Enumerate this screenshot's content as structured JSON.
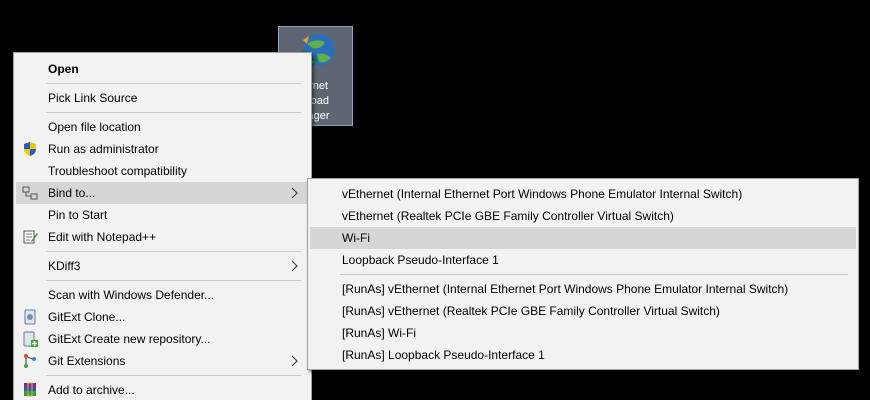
{
  "desktop_icon": {
    "caption_lines": [
      "ernet",
      "nload",
      "nager"
    ]
  },
  "context_menu": {
    "open": "Open",
    "pick_link_source": "Pick Link Source",
    "open_file_location": "Open file location",
    "run_as_administrator": "Run as administrator",
    "troubleshoot_compatibility": "Troubleshoot compatibility",
    "bind_to": "Bind to...",
    "pin_to_start": "Pin to Start",
    "edit_with_notepadpp": "Edit with Notepad++",
    "kdiff3": "KDiff3",
    "scan_with_defender": "Scan with Windows Defender...",
    "gitext_clone": "GitExt Clone...",
    "gitext_create_repo": "GitExt Create new repository...",
    "git_extensions": "Git Extensions",
    "add_to_archive": "Add to archive..."
  },
  "bind_submenu": {
    "items": [
      "vEthernet (Internal Ethernet Port Windows Phone Emulator Internal Switch)",
      "vEthernet (Realtek PCIe GBE Family Controller Virtual Switch)",
      "Wi-Fi",
      "Loopback Pseudo-Interface 1"
    ],
    "runas_items": [
      "[RunAs] vEthernet (Internal Ethernet Port Windows Phone Emulator Internal Switch)",
      "[RunAs] vEthernet (Realtek PCIe GBE Family Controller Virtual Switch)",
      "[RunAs] Wi-Fi",
      "[RunAs] Loopback Pseudo-Interface 1"
    ]
  }
}
